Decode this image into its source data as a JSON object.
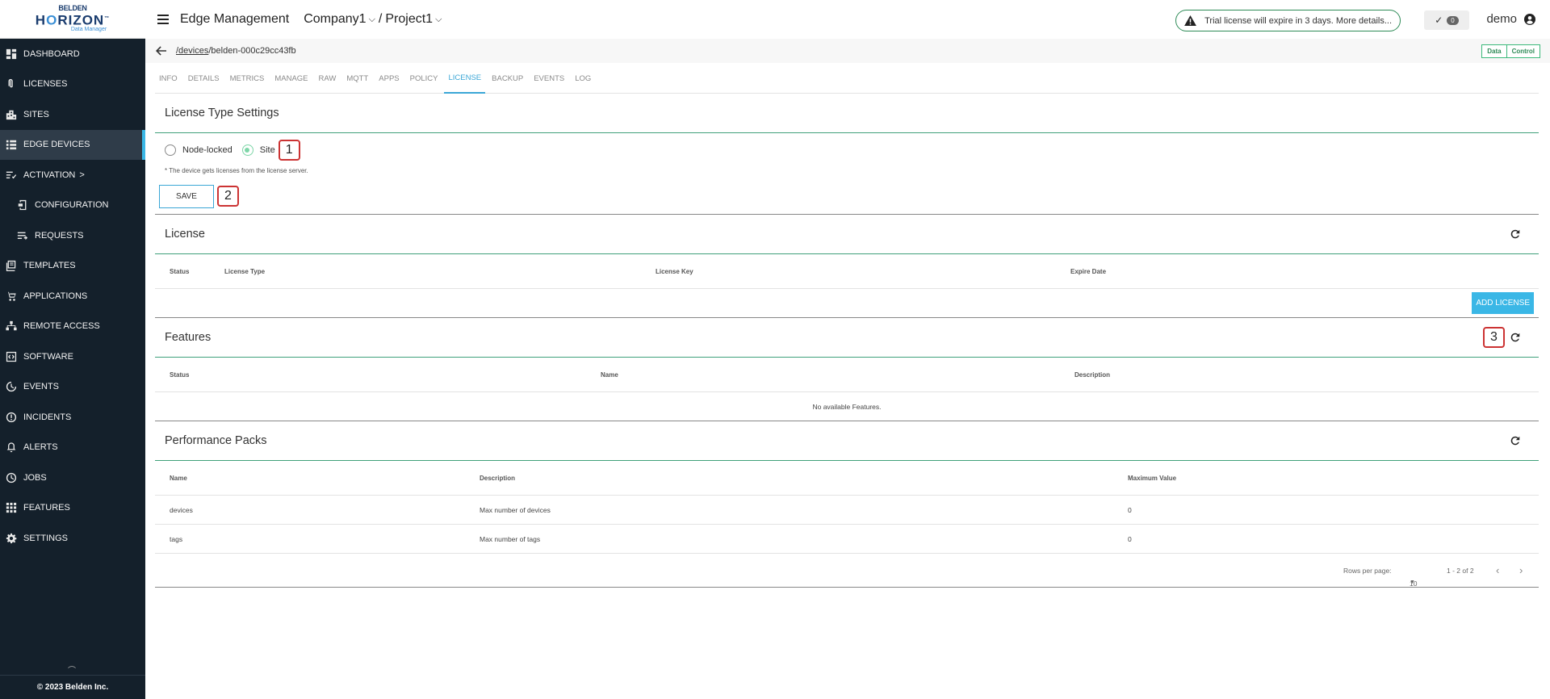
{
  "logo": {
    "brand": "BELDEN",
    "product_pre": "H",
    "product_o": "O",
    "product_post": "RIZON",
    "tm": "™",
    "sub": "Data Manager"
  },
  "sidebar": {
    "items": [
      {
        "label": "DASHBOARD",
        "icon": "dashboard-icon"
      },
      {
        "label": "LICENSES",
        "icon": "paperclip-icon"
      },
      {
        "label": "SITES",
        "icon": "building-icon"
      },
      {
        "label": "EDGE DEVICES",
        "icon": "list-icon",
        "active": true
      },
      {
        "label": "ACTIVATION",
        "icon": "activation-icon",
        "chevron": ">"
      },
      {
        "label": "CONFIGURATION",
        "icon": "config-icon",
        "sub": true
      },
      {
        "label": "REQUESTS",
        "icon": "requests-icon",
        "sub": true
      },
      {
        "label": "TEMPLATES",
        "icon": "templates-icon"
      },
      {
        "label": "APPLICATIONS",
        "icon": "cart-icon"
      },
      {
        "label": "REMOTE ACCESS",
        "icon": "network-icon"
      },
      {
        "label": "SOFTWARE",
        "icon": "software-icon"
      },
      {
        "label": "EVENTS",
        "icon": "events-icon"
      },
      {
        "label": "INCIDENTS",
        "icon": "incident-icon"
      },
      {
        "label": "ALERTS",
        "icon": "bell-icon"
      },
      {
        "label": "JOBS",
        "icon": "clock-icon"
      },
      {
        "label": "FEATURES",
        "icon": "grid-icon"
      },
      {
        "label": "SETTINGS",
        "icon": "gear-icon"
      }
    ],
    "footer": "© 2023 Belden Inc."
  },
  "header": {
    "title": "Edge Management",
    "company": "Company1",
    "separator": "/",
    "project": "Project1",
    "trial": "Trial license will expire in 3 days. More details...",
    "check_count": "0",
    "user": "demo"
  },
  "subheader": {
    "path_link": "/devices",
    "path_rest": "/belden-000c29cc43fb",
    "toggle_data": "Data",
    "toggle_control": "Control"
  },
  "tabs": [
    "INFO",
    "DETAILS",
    "METRICS",
    "MANAGE",
    "RAW",
    "MQTT",
    "APPS",
    "POLICY",
    "LICENSE",
    "BACKUP",
    "EVENTS",
    "LOG"
  ],
  "active_tab": "LICENSE",
  "license_type": {
    "title": "License Type Settings",
    "option_node": "Node-locked",
    "option_site": "Site",
    "selected": "Site",
    "note": "* The device gets licenses from the license server.",
    "save_label": "SAVE",
    "callout_1": "1",
    "callout_2": "2"
  },
  "license": {
    "title": "License",
    "columns": [
      "Status",
      "License Type",
      "License Key",
      "Expire Date"
    ],
    "add_label": "ADD LICENSE"
  },
  "features": {
    "title": "Features",
    "callout_3": "3",
    "columns": [
      "Status",
      "Name",
      "Description"
    ],
    "empty": "No available Features."
  },
  "performance": {
    "title": "Performance Packs",
    "columns": [
      "Name",
      "Description",
      "Maximum Value"
    ],
    "rows": [
      {
        "name": "devices",
        "description": "Max number of devices",
        "max": "0"
      },
      {
        "name": "tags",
        "description": "Max number of tags",
        "max": "0"
      }
    ],
    "rows_per_page_label": "Rows per page:",
    "rows_per_page": "10",
    "range": "1 - 2 of 2"
  },
  "colors": {
    "sidebar_bg": "#14202b",
    "accent": "#3ab7e6",
    "divider": "#3fa07a"
  }
}
